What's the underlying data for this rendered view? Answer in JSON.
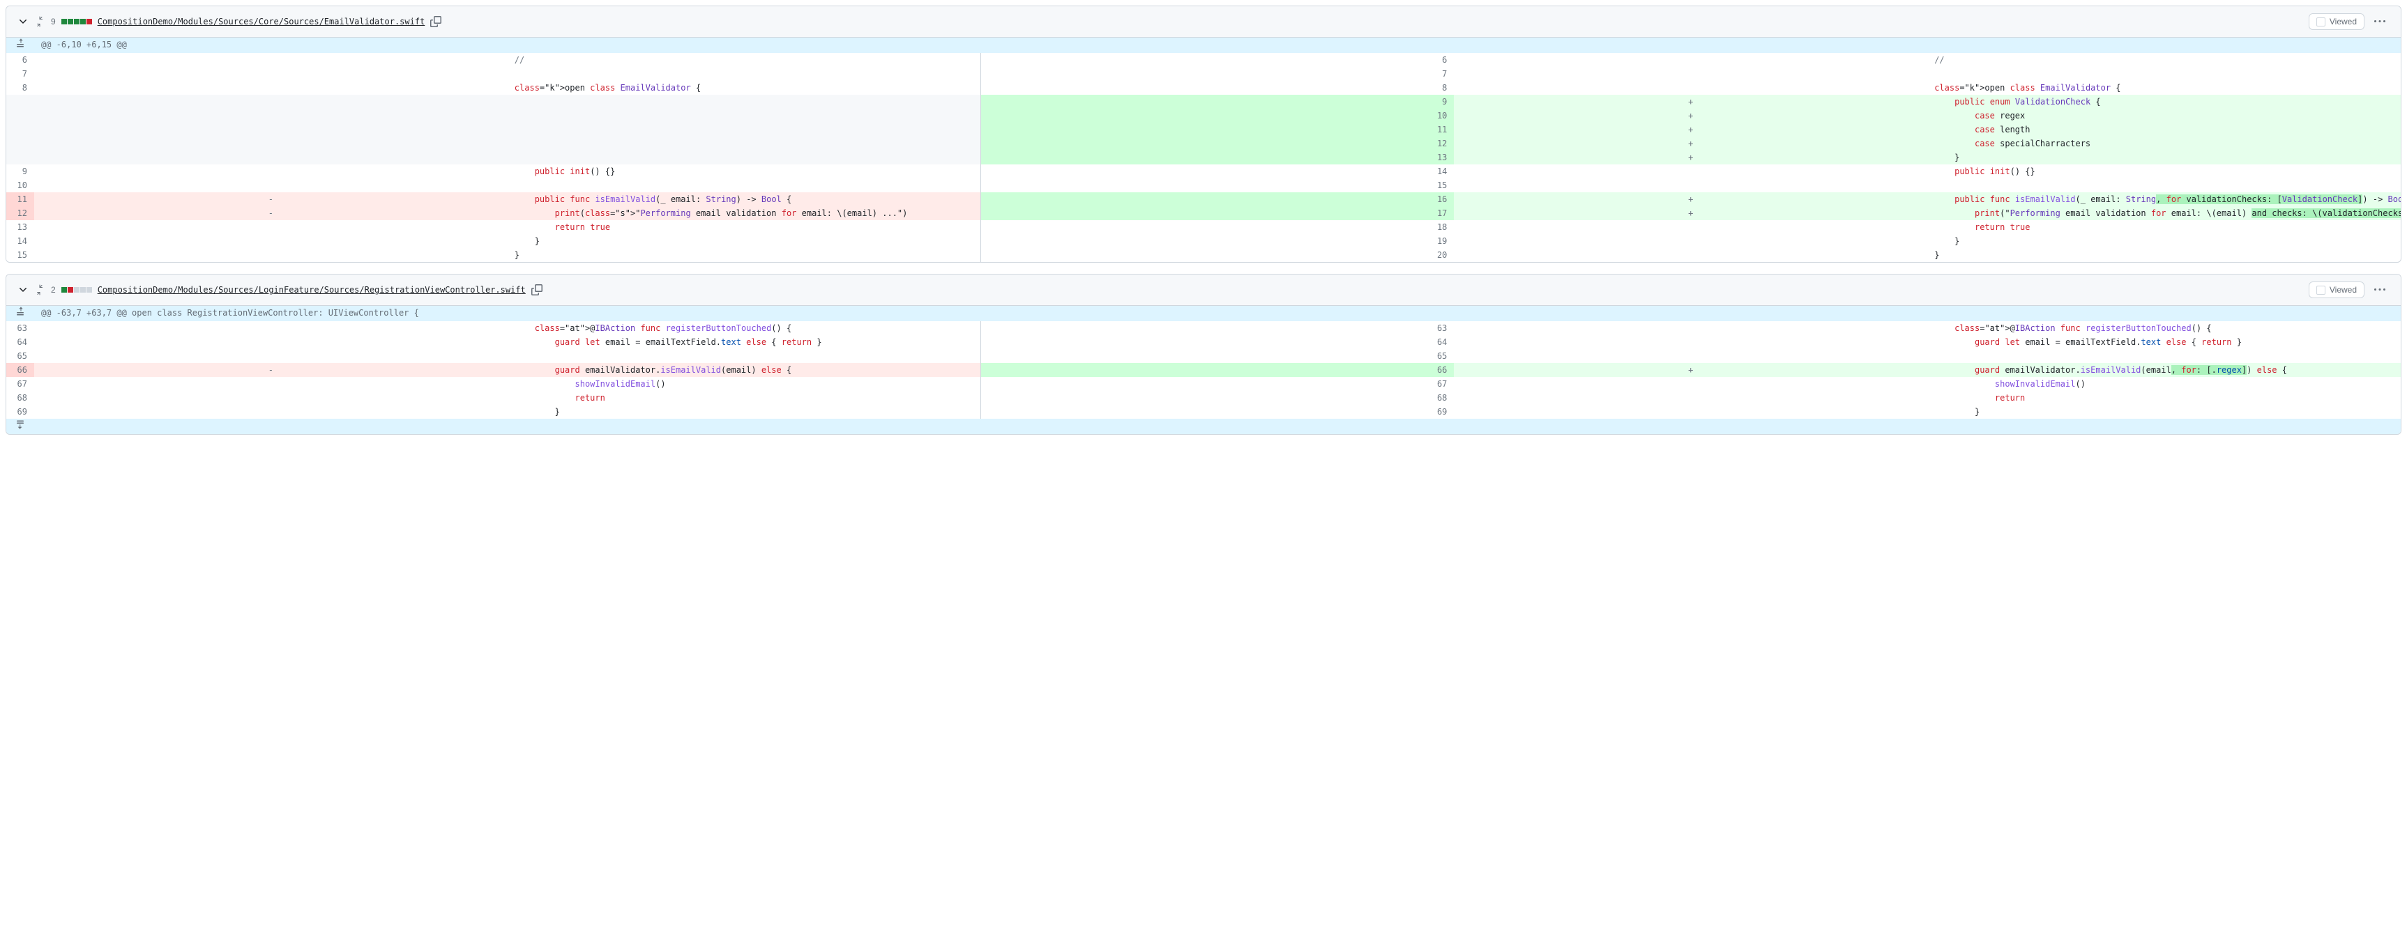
{
  "files": [
    {
      "change_count": "9",
      "squares": [
        "add",
        "add",
        "add",
        "add",
        "del"
      ],
      "path": "CompositionDemo/Modules/Sources/Core/Sources/EmailValidator.swift",
      "viewed_label": "Viewed",
      "hunk": "@@ -6,10 +6,15 @@",
      "rows": [
        {
          "l": "6",
          "r": "6",
          "lm": "",
          "rm": "",
          "lt": "//",
          "rt": "//",
          "lk": "ctx",
          "rk": "ctx"
        },
        {
          "l": "7",
          "r": "7",
          "lm": "",
          "rm": "",
          "lt": "",
          "rt": "",
          "lk": "ctx",
          "rk": "ctx"
        },
        {
          "l": "8",
          "r": "8",
          "lm": "",
          "rm": "",
          "lt": "open class EmailValidator {",
          "rt": "open class EmailValidator {",
          "lk": "ctx",
          "rk": "ctx"
        },
        {
          "l": "",
          "r": "9",
          "lm": "",
          "rm": "+",
          "lt": "",
          "rt": "    public enum ValidationCheck {",
          "lk": "empty",
          "rk": "add"
        },
        {
          "l": "",
          "r": "10",
          "lm": "",
          "rm": "+",
          "lt": "",
          "rt": "        case regex",
          "lk": "empty",
          "rk": "add"
        },
        {
          "l": "",
          "r": "11",
          "lm": "",
          "rm": "+",
          "lt": "",
          "rt": "        case length",
          "lk": "empty",
          "rk": "add"
        },
        {
          "l": "",
          "r": "12",
          "lm": "",
          "rm": "+",
          "lt": "",
          "rt": "        case specialCharracters",
          "lk": "empty",
          "rk": "add"
        },
        {
          "l": "",
          "r": "13",
          "lm": "",
          "rm": "+",
          "lt": "",
          "rt": "    }",
          "lk": "empty",
          "rk": "add"
        },
        {
          "l": "9",
          "r": "14",
          "lm": "",
          "rm": "",
          "lt": "    public init() {}",
          "rt": "    public init() {}",
          "lk": "ctx",
          "rk": "ctx"
        },
        {
          "l": "10",
          "r": "15",
          "lm": "",
          "rm": "",
          "lt": "",
          "rt": "",
          "lk": "ctx",
          "rk": "ctx"
        },
        {
          "l": "11",
          "r": "16",
          "lm": "-",
          "rm": "+",
          "lt": "    public func isEmailValid(_ email: String) -> Bool {",
          "rt": "    public func isEmailValid(_ email: String, for validationChecks: [ValidationCheck]) -> Bool {",
          "lk": "del",
          "rk": "add"
        },
        {
          "l": "12",
          "r": "17",
          "lm": "-",
          "rm": "+",
          "lt": "        print(\"Performing email validation for email: \\(email) ...\")",
          "rt": "        print(\"Performing email validation for email: \\(email) and checks: \\(validationChecks) ...\")",
          "lk": "del",
          "rk": "add"
        },
        {
          "l": "13",
          "r": "18",
          "lm": "",
          "rm": "",
          "lt": "        return true",
          "rt": "        return true",
          "lk": "ctx",
          "rk": "ctx"
        },
        {
          "l": "14",
          "r": "19",
          "lm": "",
          "rm": "",
          "lt": "    }",
          "rt": "    }",
          "lk": "ctx",
          "rk": "ctx"
        },
        {
          "l": "15",
          "r": "20",
          "lm": "",
          "rm": "",
          "lt": "}",
          "rt": "}",
          "lk": "ctx",
          "rk": "ctx"
        }
      ]
    },
    {
      "change_count": "2",
      "squares": [
        "add",
        "del",
        "neutral",
        "neutral",
        "neutral"
      ],
      "path": "CompositionDemo/Modules/Sources/LoginFeature/Sources/RegistrationViewController.swift",
      "viewed_label": "Viewed",
      "hunk": "@@ -63,7 +63,7 @@ open class RegistrationViewController: UIViewController {",
      "rows": [
        {
          "l": "63",
          "r": "63",
          "lm": "",
          "rm": "",
          "lt": "    @IBAction func registerButtonTouched() {",
          "rt": "    @IBAction func registerButtonTouched() {",
          "lk": "ctx",
          "rk": "ctx"
        },
        {
          "l": "64",
          "r": "64",
          "lm": "",
          "rm": "",
          "lt": "        guard let email = emailTextField.text else { return }",
          "rt": "        guard let email = emailTextField.text else { return }",
          "lk": "ctx",
          "rk": "ctx"
        },
        {
          "l": "65",
          "r": "65",
          "lm": "",
          "rm": "",
          "lt": "",
          "rt": "",
          "lk": "ctx",
          "rk": "ctx"
        },
        {
          "l": "66",
          "r": "66",
          "lm": "-",
          "rm": "+",
          "lt": "        guard emailValidator.isEmailValid(email) else {",
          "rt": "        guard emailValidator.isEmailValid(email, for: [.regex]) else {",
          "lk": "del",
          "rk": "add"
        },
        {
          "l": "67",
          "r": "67",
          "lm": "",
          "rm": "",
          "lt": "            showInvalidEmail()",
          "rt": "            showInvalidEmail()",
          "lk": "ctx",
          "rk": "ctx"
        },
        {
          "l": "68",
          "r": "68",
          "lm": "",
          "rm": "",
          "lt": "            return",
          "rt": "            return",
          "lk": "ctx",
          "rk": "ctx"
        },
        {
          "l": "69",
          "r": "69",
          "lm": "",
          "rm": "",
          "lt": "        }",
          "rt": "        }",
          "lk": "ctx",
          "rk": "ctx"
        }
      ],
      "expand_down": true
    }
  ]
}
